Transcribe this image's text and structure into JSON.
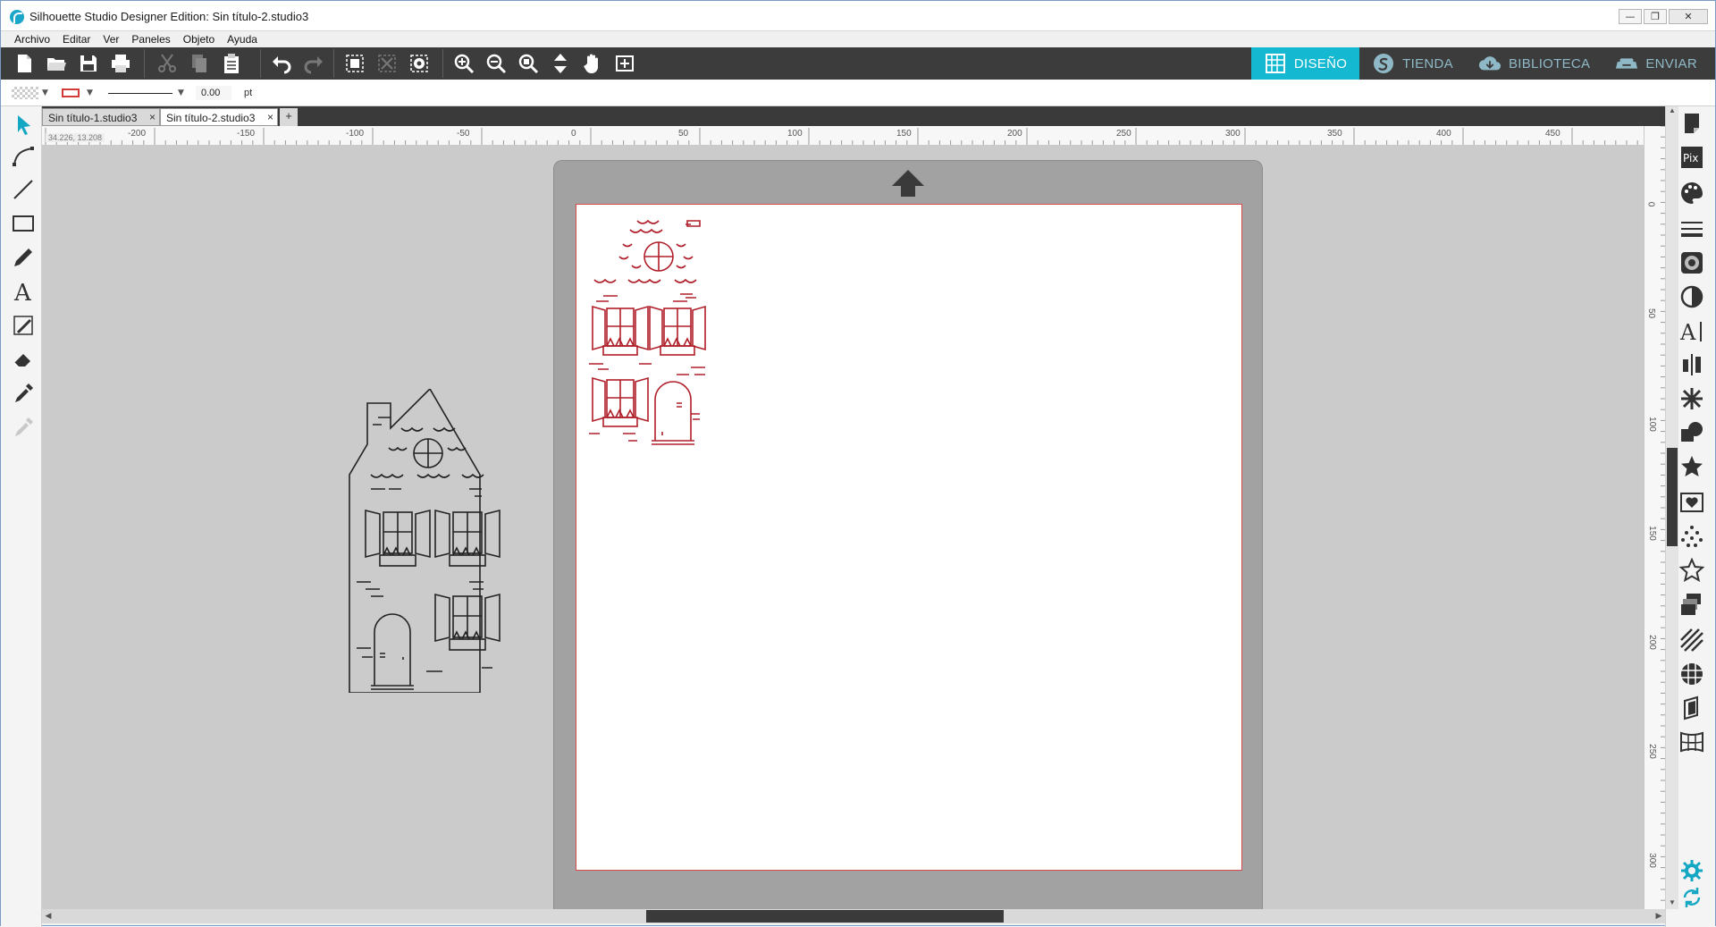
{
  "window": {
    "title": "Silhouette Studio Designer Edition: Sin título-2.studio3",
    "controls": {
      "minimize": "—",
      "maximize": "❐",
      "close": "✕"
    }
  },
  "menu": [
    "Archivo",
    "Editar",
    "Ver",
    "Paneles",
    "Objeto",
    "Ayuda"
  ],
  "nav": {
    "design": "DISEÑO",
    "store": "TIENDA",
    "library": "BIBLIOTECA",
    "send": "ENVIAR"
  },
  "style_bar": {
    "line_weight": "0.00",
    "unit": "pt"
  },
  "tabs": [
    {
      "label": "Sin título-1.studio3",
      "close": "×"
    },
    {
      "label": "Sin título-2.studio3",
      "close": "×"
    }
  ],
  "add_tab": "+",
  "ruler": {
    "coords": "34.226, 13.208",
    "top_labels": [
      "-200",
      "-150",
      "-100",
      "-50",
      "0",
      "50",
      "100",
      "150",
      "200",
      "250",
      "300",
      "350",
      "400",
      "450"
    ],
    "right_labels": [
      "0",
      "50",
      "100",
      "150",
      "200",
      "250",
      "300"
    ]
  },
  "colors": {
    "accent": "#14b8d0",
    "toolbar": "#3c3c3c",
    "cut_line": "#b01e2a",
    "canvas": "#cbcbcb",
    "mat": "#a2a2a3"
  }
}
